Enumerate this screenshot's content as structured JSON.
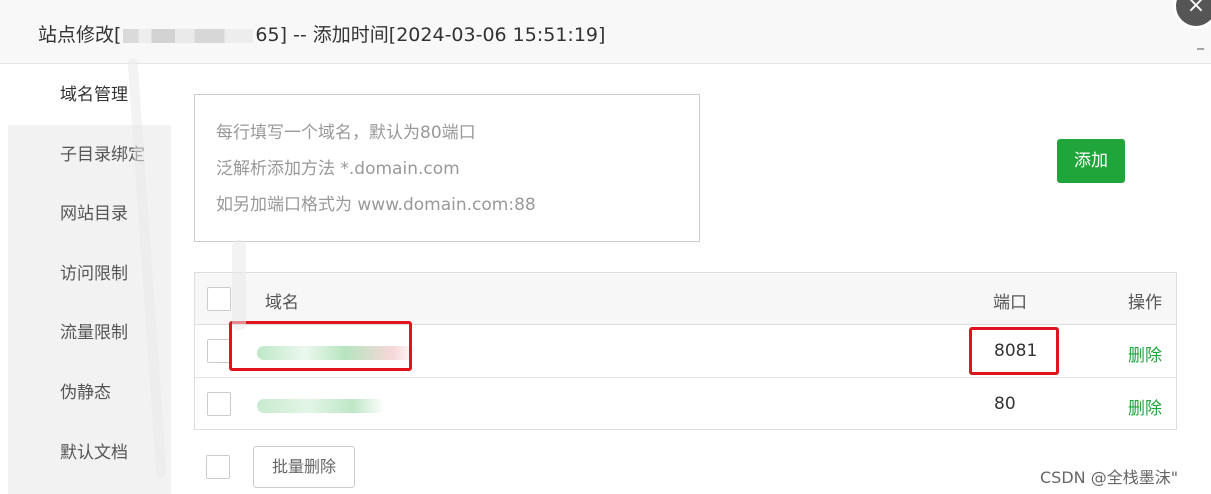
{
  "dialog": {
    "title_prefix": "站点修改[",
    "title_suffix": "65] -- 添加时间[2024-03-06 15:51:19]",
    "close_glyph": "×"
  },
  "sidenav": {
    "items": [
      {
        "label": "域名管理",
        "active": true
      },
      {
        "label": "子目录绑定",
        "active": false
      },
      {
        "label": "网站目录",
        "active": false
      },
      {
        "label": "访问限制",
        "active": false
      },
      {
        "label": "流量限制",
        "active": false
      },
      {
        "label": "伪静态",
        "active": false
      },
      {
        "label": "默认文档",
        "active": false
      }
    ]
  },
  "domain_input": {
    "placeholder_lines": [
      "每行填写一个域名，默认为80端口",
      "泛解析添加方法 *.domain.com",
      "如另加端口格式为 www.domain.com:88"
    ]
  },
  "add_button": {
    "label": "添加"
  },
  "table": {
    "headers": {
      "domain": "域名",
      "port": "端口",
      "action": "操作"
    },
    "rows": [
      {
        "domain": "",
        "port": "8081",
        "action": "删除"
      },
      {
        "domain": "",
        "port": "80",
        "action": "删除"
      }
    ]
  },
  "batch_delete": {
    "label": "批量删除"
  },
  "watermark": "CSDN @全栈墨沫\"",
  "colors": {
    "accent_green": "#20a53a",
    "highlight_red": "#e0141f"
  }
}
